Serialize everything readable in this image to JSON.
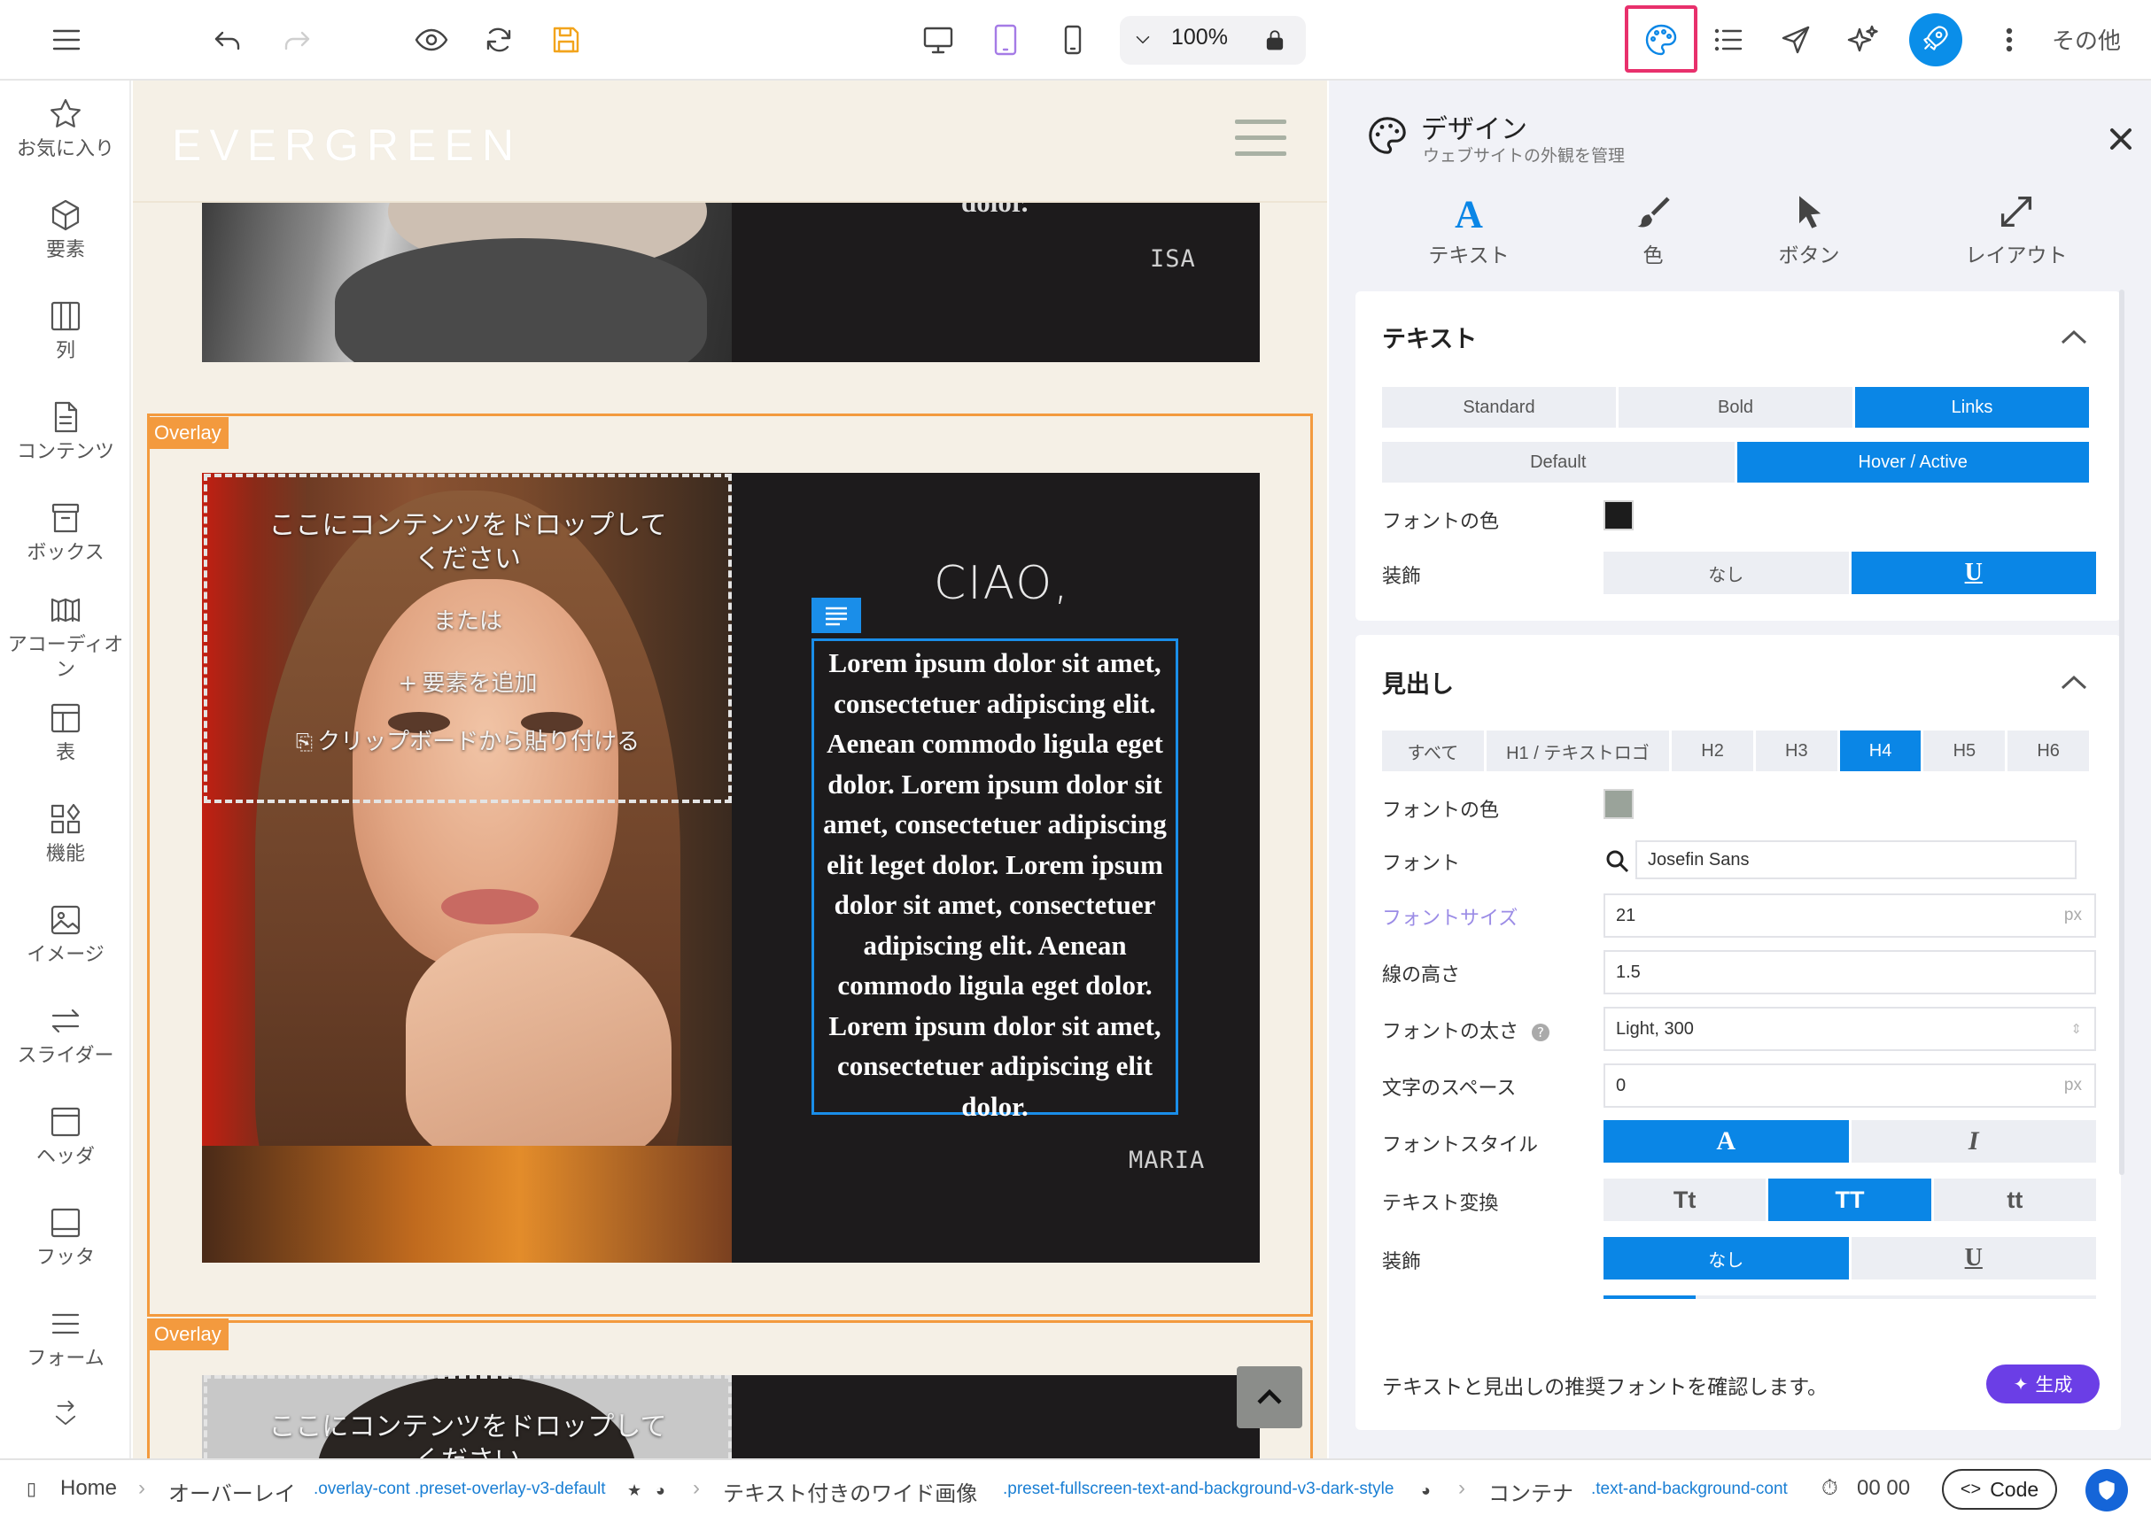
{
  "toolbar": {
    "zoom": "100%",
    "more_label": "その他",
    "icons": [
      "menu-icon",
      "undo-icon",
      "redo-icon",
      "eye-icon",
      "refresh-icon",
      "save-icon",
      "desktop-icon",
      "tablet-icon",
      "mobile-icon",
      "chevron-down-icon",
      "lock-icon",
      "palette-icon",
      "list-icon",
      "send-icon",
      "sparkle-icon",
      "rocket-icon",
      "more-icon"
    ]
  },
  "sidebar": {
    "items": [
      {
        "label": "お気に入り",
        "icon": "star-icon"
      },
      {
        "label": "要素",
        "icon": "cube-icon"
      },
      {
        "label": "列",
        "icon": "columns-icon"
      },
      {
        "label": "コンテンツ",
        "icon": "document-icon"
      },
      {
        "label": "ボックス",
        "icon": "box-icon"
      },
      {
        "label": "アコーディオン",
        "icon": "accordion-icon"
      },
      {
        "label": "表",
        "icon": "table-icon"
      },
      {
        "label": "機能",
        "icon": "features-icon"
      },
      {
        "label": "イメージ",
        "icon": "image-icon"
      },
      {
        "label": "スライダー",
        "icon": "slider-icon"
      },
      {
        "label": "ヘッダ",
        "icon": "header-icon"
      },
      {
        "label": "フッタ",
        "icon": "footer-icon"
      },
      {
        "label": "フォーム",
        "icon": "form-icon"
      }
    ]
  },
  "canvas": {
    "logo": "EVERGREEN",
    "top_fragment": "dolor.",
    "sig_isa": "ISA",
    "overlay_tag_1": "Overlay",
    "overlay_tag_2": "Overlay",
    "dropzone": {
      "drop_text": "ここにコンテンツをドロップして ください",
      "or": "または",
      "add": "要素を追加",
      "paste": "クリップボードから貼り付ける"
    },
    "dropzone2_text": "ここにコンテンツをドロップして ください",
    "ciao": "CIAO,",
    "lorem": "Lorem ipsum dolor sit amet, consectetuer adipiscing elit. Aenean commodo ligula eget dolor. Lorem ipsum dolor sit amet, consectetuer adipiscing elit leget dolor. Lorem ipsum dolor sit amet, consectetuer adipiscing elit. Aenean commodo ligula eget dolor. Lorem ipsum dolor sit amet, consectetuer adipiscing elit dolor.",
    "sig_maria": "MARIA"
  },
  "panel": {
    "title": "デザイン",
    "subtitle": "ウェブサイトの外観を管理",
    "tabs": [
      {
        "label": "テキスト",
        "icon": "text-a-icon"
      },
      {
        "label": "色",
        "icon": "brush-icon"
      },
      {
        "label": "ボタン",
        "icon": "cursor-icon"
      },
      {
        "label": "レイアウト",
        "icon": "expand-icon"
      }
    ],
    "text_section": {
      "title": "テキスト",
      "styles": [
        "Standard",
        "Bold",
        "Links"
      ],
      "styles_active": "Links",
      "states": [
        "Default",
        "Hover / Active"
      ],
      "states_active": "Hover / Active",
      "font_color_label": "フォントの色",
      "font_color": "#1c1c1c",
      "decoration_label": "装飾",
      "decoration_options": [
        "なし",
        "U"
      ],
      "decoration_active": "U"
    },
    "heading_section": {
      "title": "見出し",
      "levels": [
        "すべて",
        "H1 / テキストロゴ",
        "H2",
        "H3",
        "H4",
        "H5",
        "H6"
      ],
      "levels_active": "H4",
      "font_color_label": "フォントの色",
      "font_color": "#9aa39a",
      "font_label": "フォント",
      "font_value": "Josefin Sans",
      "font_size_label": "フォントサイズ",
      "font_size": "21",
      "font_size_unit": "px",
      "line_height_label": "線の高さ",
      "line_height": "1.5",
      "weight_label": "フォントの太さ",
      "weight_value": "Light, 300",
      "spacing_label": "文字のスペース",
      "spacing": "0",
      "spacing_unit": "px",
      "style_label": "フォントスタイル",
      "style_options": [
        "A",
        "I"
      ],
      "style_active": "A",
      "transform_label": "テキスト変換",
      "transform_options": [
        "Tt",
        "TT",
        "tt"
      ],
      "transform_active": "TT",
      "decoration_label": "装飾",
      "decoration_options": [
        "なし",
        "U"
      ],
      "decoration_active": "なし"
    },
    "recommend_text": "テキストと見出しの推奨フォントを確認します。",
    "generate_label": "生成"
  },
  "bottom": {
    "home": "Home",
    "crumb1": "オーバーレイ",
    "crumb1_class": ".overlay-cont .preset-overlay-v3-default",
    "crumb2": "テキスト付きのワイド画像",
    "crumb2_class": ".preset-fullscreen-text-and-background-v3-dark-style",
    "crumb3": "コンテナ",
    "crumb3_class": ".text-and-background-cont",
    "timer": "00 00",
    "code": "Code"
  },
  "colors": {
    "accent": "#0a86e6",
    "highlight": "#e8306c",
    "overlay": "#f39a3e",
    "generate": "#6b3ee6"
  }
}
